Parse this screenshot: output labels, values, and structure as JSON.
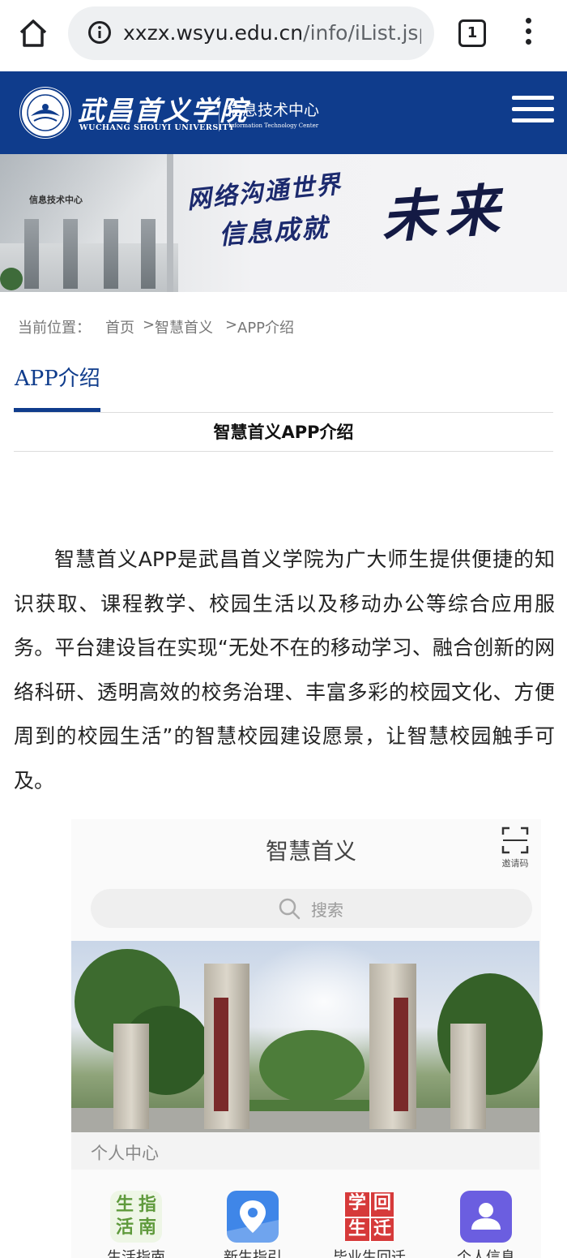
{
  "browser": {
    "url_host": "xxzx.wsyu.edu.cn",
    "url_path": "/info/iList.jsp",
    "tab_count": "1",
    "icons": [
      "home-icon",
      "info-icon",
      "tabs-icon",
      "more-vert-icon"
    ]
  },
  "header": {
    "logo_cn": "武昌首义学院",
    "logo_en": "WUCHANG SHOUYI UNIVERSITY",
    "dept_cn": "信息技术中心",
    "dept_en": "Information Technology Center",
    "brand_color": "#0f3c8c"
  },
  "banner": {
    "sign_text": "信息技术中心",
    "slogan_line1": "网络沟通世界",
    "slogan_line2": "信息成就",
    "slogan_big": "未来"
  },
  "breadcrumb": {
    "label": "当前位置：",
    "items": [
      "首页",
      "智慧首义",
      "APP介绍"
    ],
    "separator": ">"
  },
  "section": {
    "title": "APP介绍"
  },
  "article": {
    "title": "智慧首义APP介绍",
    "body": "智慧首义APP是武昌首义学院为广大师生提供便捷的知识获取、课程教学、校园生活以及移动办公等综合应用服务。平台建设旨在实现“无处不在的移动学习、融合创新的网络科研、透明高效的校务治理、丰富多彩的校园文化、方便周到的校园生活”的智慧校园建设愿景，让智慧校园触手可及。"
  },
  "app_screenshot": {
    "title": "智慧首义",
    "invite_label": "邀请码",
    "search_placeholder": "搜索",
    "personal_center": "个人中心",
    "tiles": [
      {
        "glyphs": [
          "生",
          "指",
          "活",
          "南"
        ],
        "caption": "生活指南",
        "color": "#5f9a3c"
      },
      {
        "glyphs": [],
        "caption": "新生指引",
        "color": "#3f86e8"
      },
      {
        "glyphs": [
          "学",
          "回",
          "生",
          "迁"
        ],
        "caption": "毕业生回迁",
        "color": "#d63a3a"
      },
      {
        "glyphs": [],
        "caption": "个人信息",
        "color": "#6b5ee0"
      }
    ]
  }
}
